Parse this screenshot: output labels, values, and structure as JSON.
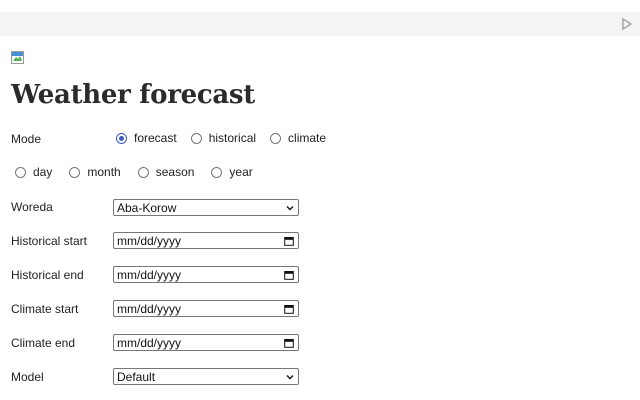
{
  "page": {
    "title": "Weather forecast"
  },
  "mode": {
    "label": "Mode",
    "options": [
      {
        "label": "forecast",
        "checked": true
      },
      {
        "label": "historical",
        "checked": false
      },
      {
        "label": "climate",
        "checked": false
      }
    ]
  },
  "period": {
    "options": [
      {
        "label": "day",
        "checked": false
      },
      {
        "label": "month",
        "checked": false
      },
      {
        "label": "season",
        "checked": false
      },
      {
        "label": "year",
        "checked": false
      }
    ]
  },
  "woreda": {
    "label": "Woreda",
    "value": "Aba-Korow"
  },
  "historical_start": {
    "label": "Historical start",
    "value": "mm/dd/yyyy"
  },
  "historical_end": {
    "label": "Historical end",
    "value": "mm/dd/yyyy"
  },
  "climate_start": {
    "label": "Climate start",
    "value": "mm/dd/yyyy"
  },
  "climate_end": {
    "label": "Climate end",
    "value": "mm/dd/yyyy"
  },
  "model": {
    "label": "Model",
    "value": "Default"
  },
  "colors": {
    "radio_checked": "#3b5fc0",
    "topbar": "#f4f4f4"
  },
  "icons": {
    "run": "play-icon",
    "image": "broken-image-icon",
    "select": "chevron-down-icon",
    "date": "calendar-icon"
  }
}
